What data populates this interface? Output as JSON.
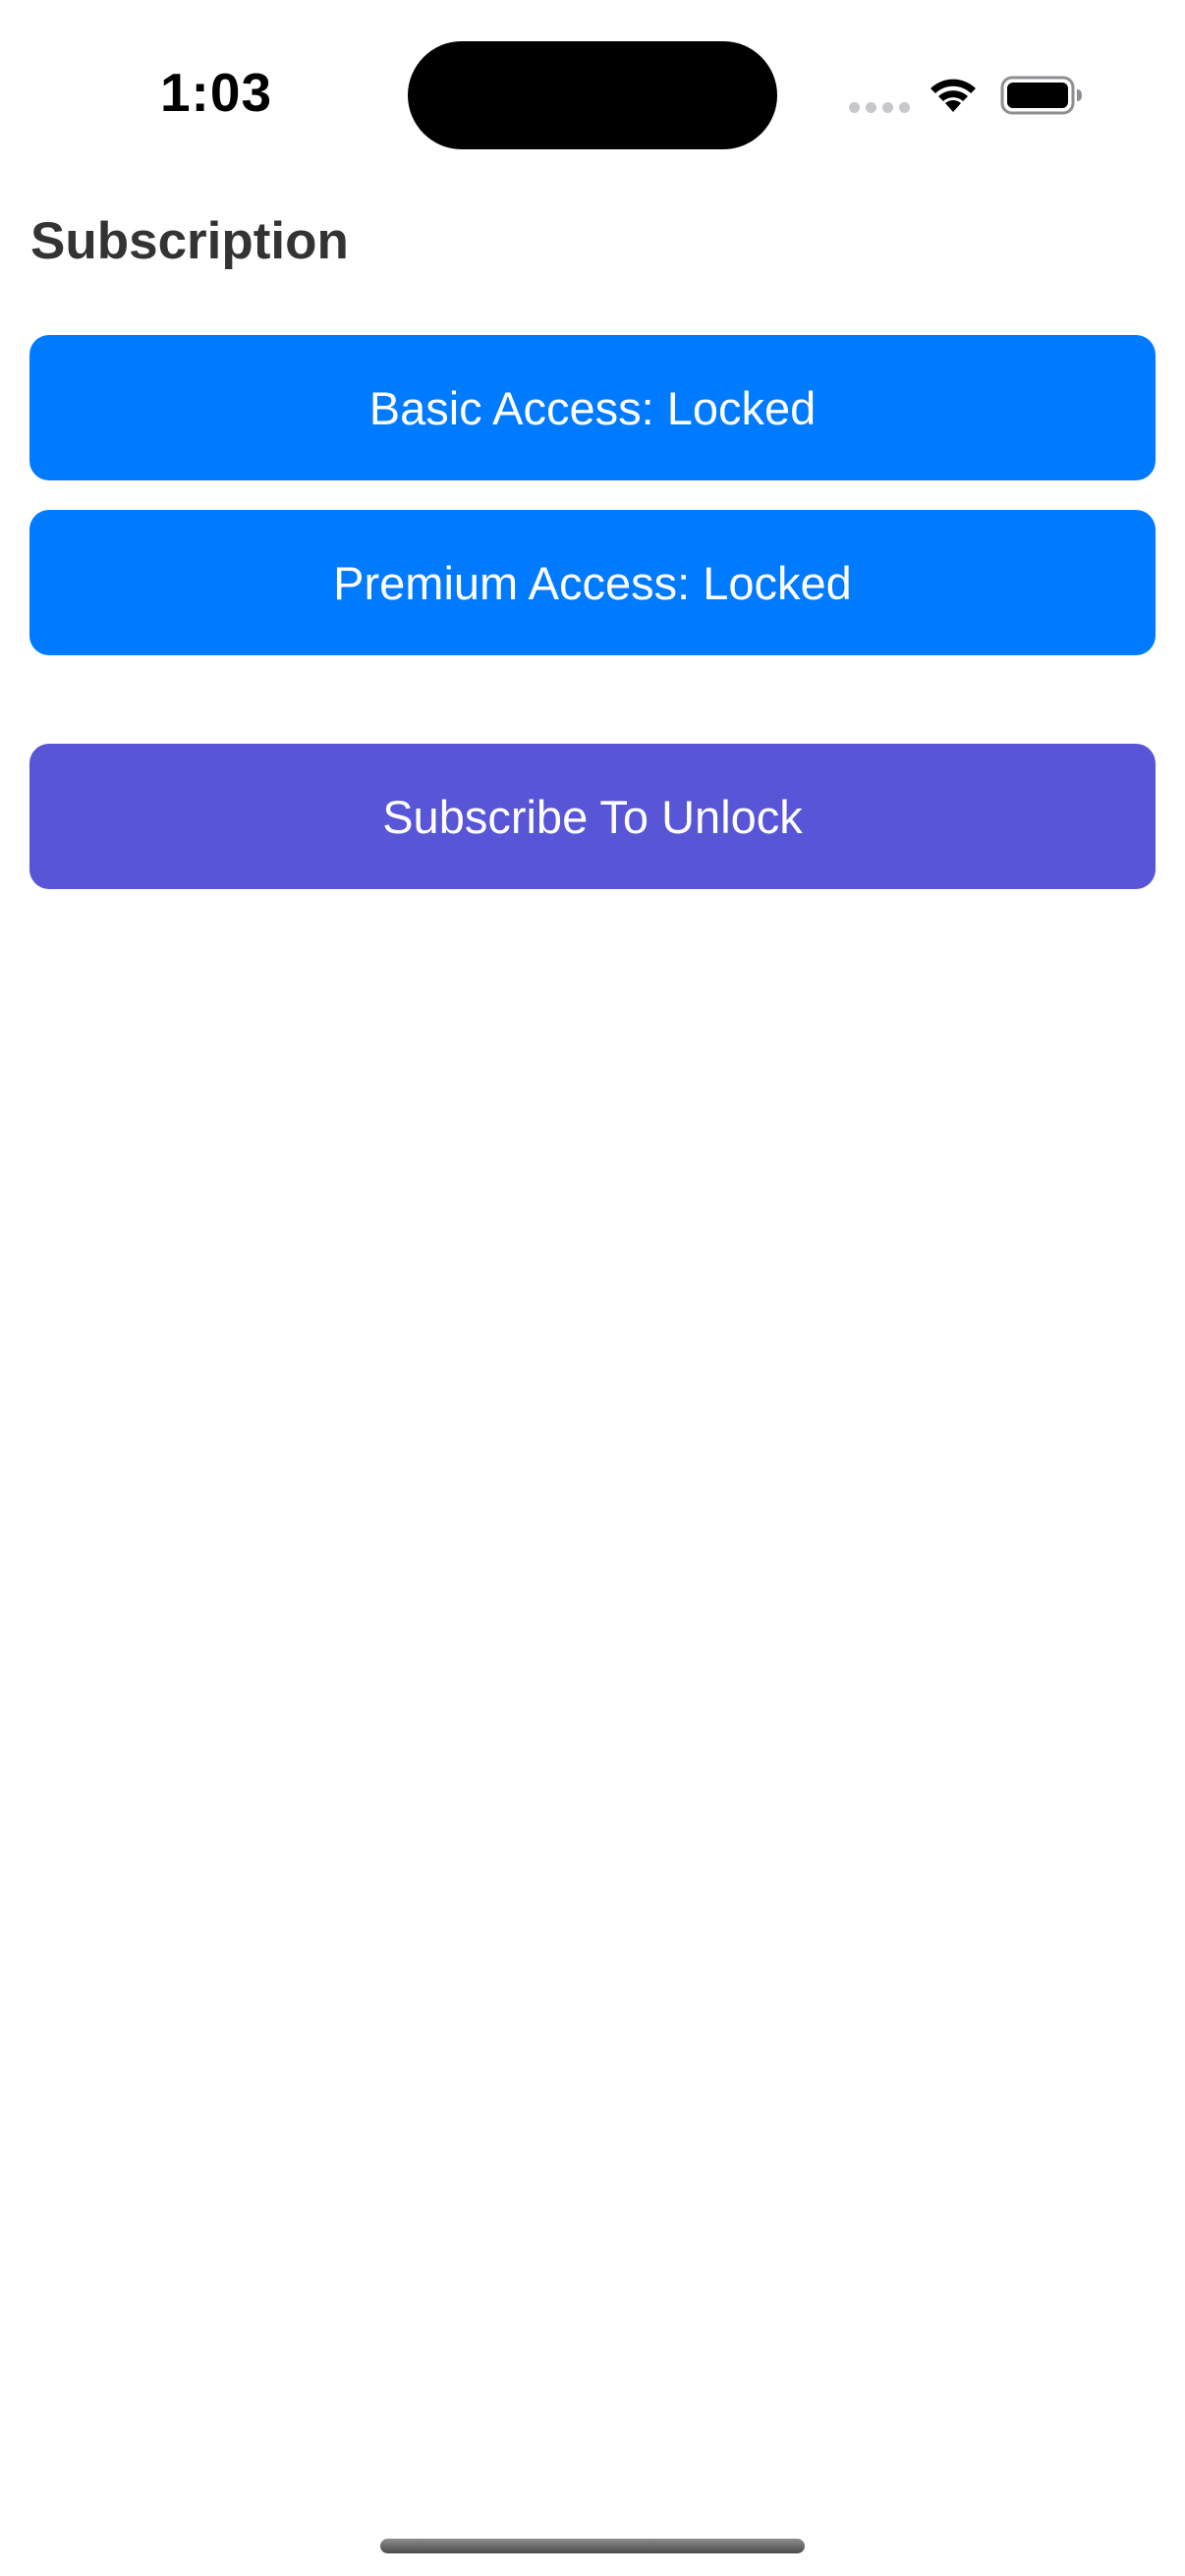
{
  "status_bar": {
    "time": "1:03",
    "icons": [
      "signal-dots-icon",
      "wifi-icon",
      "battery-icon"
    ]
  },
  "page": {
    "title": "Subscription"
  },
  "buttons": {
    "basic_access": "Basic Access: Locked",
    "premium_access": "Premium Access: Locked",
    "subscribe": "Subscribe To Unlock"
  },
  "colors": {
    "access_button": "#007AFF",
    "subscribe_button": "#5856D6",
    "title_text": "#333333",
    "background": "#FFFFFF"
  }
}
